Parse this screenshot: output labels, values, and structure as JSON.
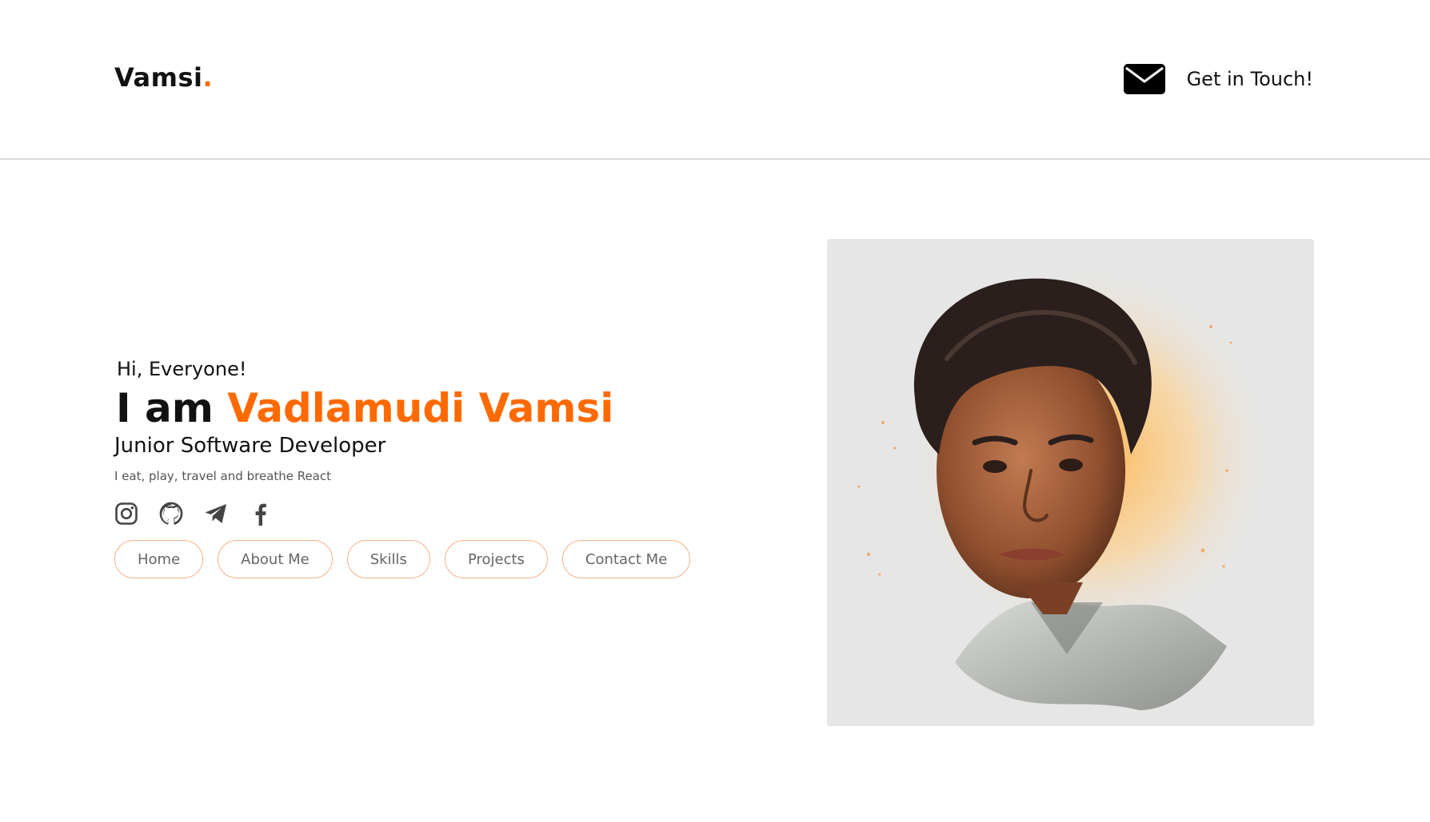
{
  "header": {
    "logo_text": "Vamsi",
    "logo_dot": ".",
    "contact_label": "Get in Touch!"
  },
  "hero": {
    "greeting": "Hi, Everyone!",
    "intro_prefix": "I am",
    "name": "Vadlamudi Vamsi",
    "role": "Junior Software Developer",
    "tagline": "I eat, play, travel and breathe React"
  },
  "socials": [
    "instagram-icon",
    "github-icon",
    "telegram-icon",
    "facebook-icon"
  ],
  "nav": {
    "home": "Home",
    "about": "About Me",
    "skills": "Skills",
    "projects": "Projects",
    "contact": "Contact Me"
  },
  "colors": {
    "accent": "#ff6a00",
    "pill_border": "#f5b08a",
    "portrait_bg": "#e6e6e6"
  }
}
